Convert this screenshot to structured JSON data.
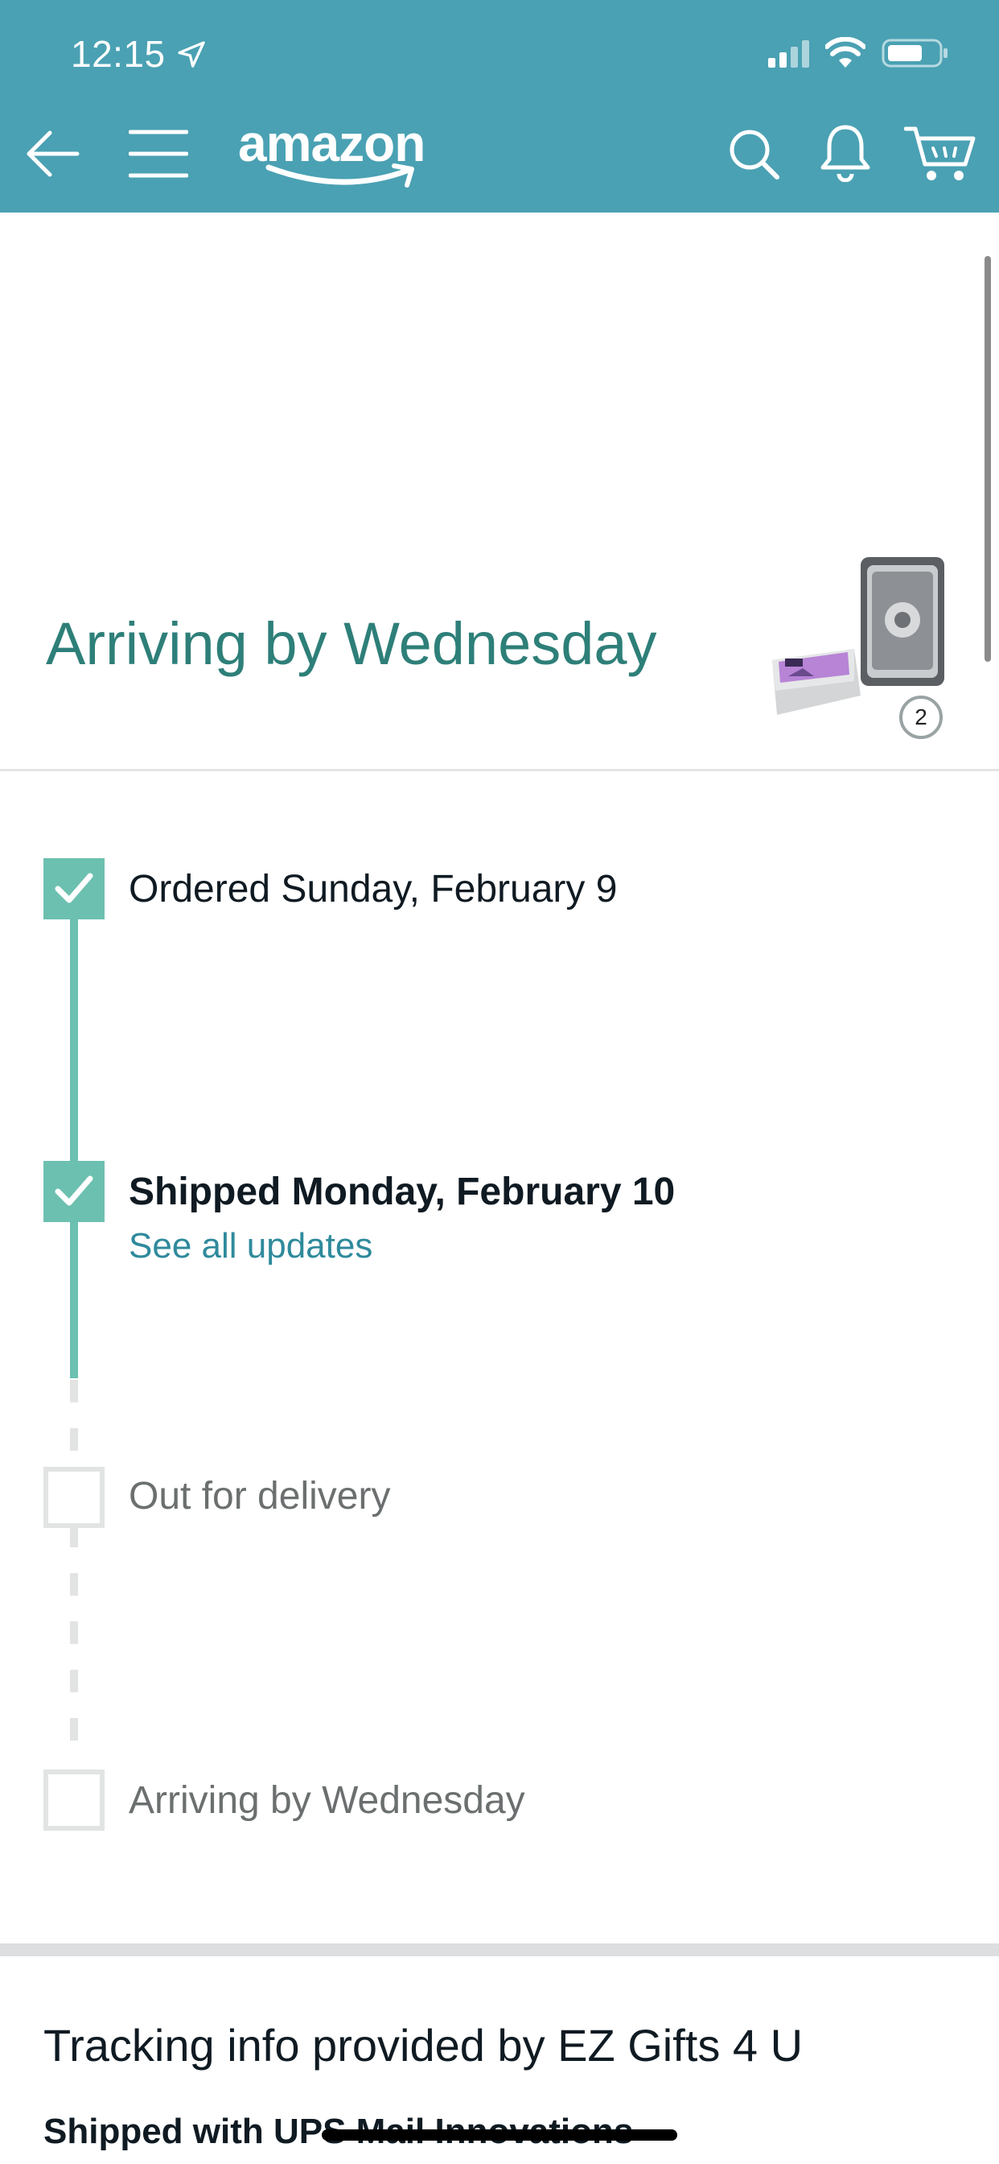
{
  "status_bar": {
    "time": "12:15",
    "icons": [
      "location-arrow-icon",
      "signal-icon",
      "wifi-icon",
      "battery-icon"
    ]
  },
  "header": {
    "background_color": "#4aa1b3",
    "logo_text": "amazon",
    "icons": [
      "back-arrow-icon",
      "hamburger-menu-icon",
      "search-icon",
      "bell-icon",
      "cart-icon"
    ]
  },
  "arrival": {
    "title": "Arriving by Wednesday",
    "title_color": "#2e7f79",
    "item_count": "2"
  },
  "timeline": {
    "accent_color": "#6cc0b0",
    "steps": [
      {
        "label": "Ordered Sunday, February 9",
        "status": "done"
      },
      {
        "label": "Shipped Monday, February 10",
        "status": "done",
        "link": "See all updates"
      },
      {
        "label": "Out for delivery",
        "status": "pending"
      },
      {
        "label": "Arriving by Wednesday",
        "status": "pending"
      }
    ]
  },
  "tracking": {
    "title": "Tracking info provided by EZ Gifts 4 U",
    "shipped_with": "Shipped with UPS Mail Innovations"
  }
}
